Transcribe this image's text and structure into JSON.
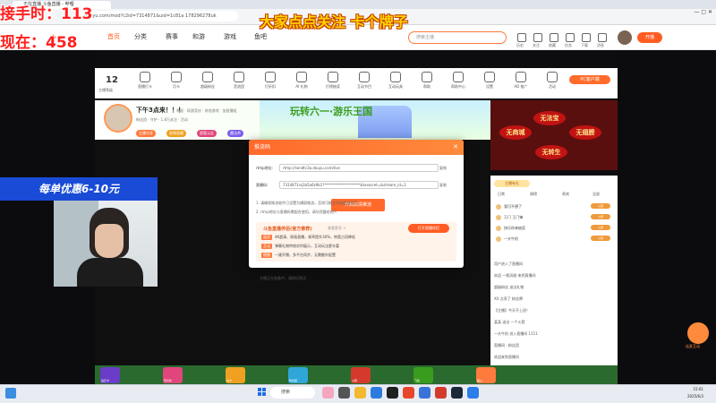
{
  "browser": {
    "tab_title": "正在直播 斗鱼直播 - 哔哩",
    "address": "douyu.com/mod?c2id=7314871&uid=1c81a 178296278uk"
  },
  "overlay": {
    "counter_line1": "接手时：113",
    "counter_line2": "现在：458",
    "marquee": "大家点点关注 卡个牌子",
    "promo_banner": "每单优惠6-10元"
  },
  "header": {
    "nav": [
      "首页",
      "分类",
      "赛事",
      "和游",
      "游戏",
      "鱼吧"
    ],
    "search_placeholder": "搜索主播",
    "icons": [
      "历史",
      "关注",
      "收藏",
      "任务",
      "下载",
      "消息"
    ],
    "open_button": "开播"
  },
  "gift_bar": {
    "level_number": "12",
    "level_label": "主播等级",
    "items": [
      "直播打卡",
      "月卡",
      "超级粉丝",
      "音浪团",
      "打折扣",
      "AI 礼物",
      "打榜抽奖",
      "互动节目",
      "互动玩具",
      "帮助",
      "帮助中心",
      "设置",
      "AD 推广",
      "活动"
    ],
    "pc_button": "PC客户端"
  },
  "streamer": {
    "title": "下午3点来！！！",
    "meta": "举报 · 网游竞技 · 其他游戏 · 加直播组",
    "meta2": "粉丝团 · 守护 · 1.8万关注 · 活动",
    "tags": [
      "主播分享",
      "视频直播",
      "超管认证",
      "魔法师"
    ],
    "banner_text": "玩转六一·游乐王国"
  },
  "ad": {
    "bubbles": [
      "无法宝",
      "无商城",
      "无翅膀",
      "无转生"
    ]
  },
  "chat": {
    "tabs": [
      "日常",
      "周榜",
      "贵宾",
      "全部"
    ],
    "header_tag": "主播有礼",
    "ranks": [
      {
        "name": "我可不想了",
        "badge": "火箭"
      },
      {
        "name": "万门 王门锋",
        "badge": "火箭"
      },
      {
        "name": "快乐你来抽奖",
        "badge": "火箭"
      },
      {
        "name": "一头牛奶",
        "badge": "火箭"
      }
    ],
    "messages": [
      "用户进入了直播间",
      "欢迎 一帆风顺 来到直播间",
      "超级粉丝 送出礼物",
      "XX 点亮了 粉丝牌",
      "【主播】今天不上班！",
      "某某 送出 一个火箭",
      "一头牛奶 进入直播间 1111",
      "直播间 · 粉丝团",
      "欢迎来到直播间"
    ],
    "input_placeholder": "这里输入聊天内容"
  },
  "modal": {
    "title": "推流码",
    "rtmp_label": "rtmp地址:",
    "rtmp_value": "rtmp://sendtc3a.douyu.com/live",
    "copy_label": "复制",
    "key_label": "直播码:",
    "key_value": "7314871rq1b5a6z9b1?********************&txsecret=&stream_id=1",
    "copy_label2": "复制",
    "note1": "1. 请确保推流软件已设置为横屏推流，否则可能会导致画面异常",
    "note2": "2. rtmp地址与直播码需配合使用，请勿泄露给他人",
    "cta_button": "开启高清推流",
    "promo_title": "斗鱼直播伴侣(官方推荐)",
    "promo_link": "查看更多 >",
    "promo_button": "打开直播伴侣",
    "promo_lines": [
      {
        "tag": "画质",
        "text": "4K超清、原画直播，帧率提升30%，带宽占用降低"
      },
      {
        "tag": "互动",
        "text": "弹幕礼物特效实时展示，互动玩法更丰富"
      },
      {
        "tag": "便捷",
        "text": "一键开播，多平台同步，无需额外配置"
      }
    ]
  },
  "video": {
    "bottom_text": "主播正在准备中，请稍后再试"
  },
  "gift_strip": {
    "labels": [
      "钻石卡",
      "荧光棒",
      "办卡",
      "粉丝团",
      "火箭",
      "飞机",
      "超火"
    ]
  },
  "side_widget": {
    "label": "连麦互动"
  },
  "taskbar": {
    "search_label": "搜索",
    "time": "15:01",
    "date": "2025/6/3"
  }
}
